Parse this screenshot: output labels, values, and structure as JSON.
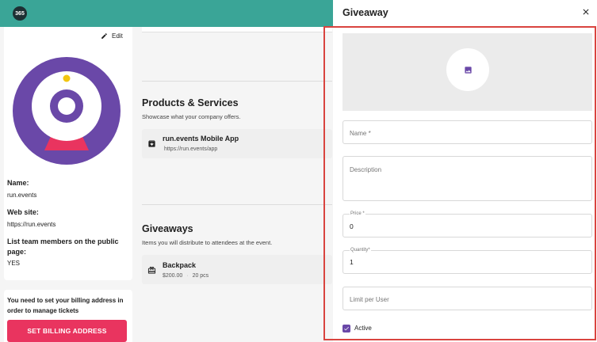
{
  "topbar": {
    "logo_text": "365",
    "color": "#3aa597"
  },
  "profile": {
    "edit_label": "Edit",
    "name_label": "Name:",
    "name_value": "run.events",
    "website_label": "Web site:",
    "website_value": "https://run.events",
    "team_label_line1": "List team members on the public",
    "team_label_line2": "page:",
    "team_value": "YES"
  },
  "billing": {
    "message_line1": "You need to set your billing address in",
    "message_line2": "order to manage tickets",
    "button_label": "SET BILLING ADDRESS",
    "button_color": "#e9345f"
  },
  "products": {
    "title": "Products & Services",
    "subtitle": "Showcase what your company offers.",
    "items": [
      {
        "name": "run.events Mobile App",
        "detail": "https://run.events/app",
        "icon": "archive-icon"
      }
    ]
  },
  "giveaways": {
    "title": "Giveaways",
    "subtitle": "Items you will distribute to attendees at the event.",
    "items": [
      {
        "name": "Backpack",
        "price": "$200.00",
        "separator": "·",
        "qty": "20 pcs",
        "icon": "gift-icon"
      }
    ]
  },
  "drawer": {
    "title": "Giveaway",
    "image_icon": "image-icon",
    "fields": {
      "name_placeholder": "Name *",
      "description_placeholder": "Description",
      "price_label": "Price *",
      "price_value": "0",
      "quantity_label": "Quantity*",
      "quantity_value": "1",
      "limit_placeholder": "Limit per User"
    },
    "active_label": "Active",
    "active_checked": true,
    "accent": "#6a48a8",
    "highlight_border": "#d9443f"
  }
}
